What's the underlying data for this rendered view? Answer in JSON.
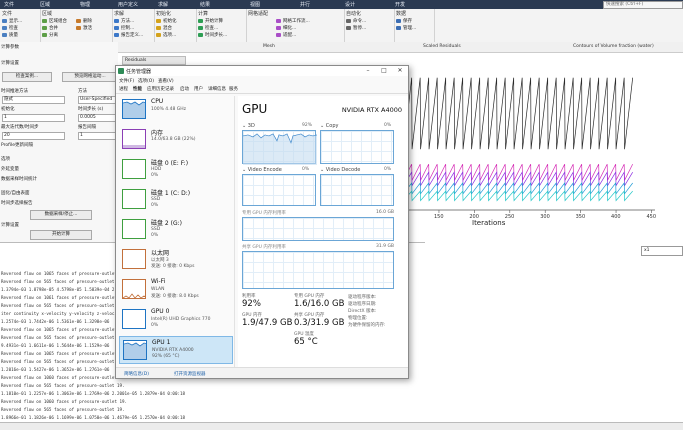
{
  "ribbon": {
    "tabs": [
      "文件",
      "区域",
      "物理",
      "用户定义",
      "求解",
      "结果",
      "视图",
      "并行",
      "设计",
      "开发"
    ],
    "search_placeholder": "快速搜索 (Ctrl+F)",
    "groups": [
      {
        "title": "文件",
        "items": [
          "显示...",
          "检查",
          "质量",
          "变换...",
          "制造..."
        ]
      },
      {
        "title": "区域",
        "items": [
          "区域组合",
          "合并",
          "分离",
          "删除",
          "激活"
        ]
      },
      {
        "title": "求解",
        "items": [
          "方法...",
          "控制...",
          "报告定义...",
          "监控..."
        ]
      },
      {
        "title": "初始化",
        "items": [
          "初始化",
          "混合",
          "选项...",
          "更多..."
        ]
      },
      {
        "title": "计算",
        "items": [
          "开始计算",
          "检查...",
          "时间步长..."
        ]
      },
      {
        "title": "网格适配",
        "items": [
          "网格工作流...",
          "细化...",
          "适配..."
        ]
      },
      {
        "title": "自动化",
        "items": [
          "命令...",
          "暂停..."
        ]
      },
      {
        "title": "数据",
        "items": [
          "保存",
          "管理..."
        ]
      }
    ]
  },
  "left_panel": {
    "rows": [
      "计算参数",
      "计算设置",
      "检查案例...",
      "预览网格运动...",
      "时间推进方法",
      "隐式",
      "初始化",
      "时间步长 (s)",
      "最大迭代数/时间步",
      "报告间隔",
      "Profile更新间隔",
      "选项",
      "外延变量",
      "数据采样时间统计",
      "固化/自由表面",
      "时间步选择报告",
      "计算设置",
      "开始计算"
    ],
    "buttons": [
      "检查案例...",
      "预览网格运动...",
      "数据采样/停止...",
      "开始计算"
    ],
    "fields": [
      "User-Specified",
      "0.0005",
      "1",
      "20",
      "1"
    ],
    "section_labels": [
      "方法",
      "时间步长",
      "步数"
    ]
  },
  "graphics": {
    "panes": [
      "Mesh",
      "Scaled Residuals",
      "Contours of Volume fraction (water)"
    ],
    "pane_tab": "Residuals",
    "x_axis_label": "Iterations",
    "x_ticks": [
      "100",
      "150",
      "200",
      "250",
      "300",
      "350",
      "400",
      "450"
    ],
    "dropdown_value": "x1"
  },
  "console": {
    "lines": [
      "Reversed flow on 1065 faces of pressure-outlet 19.",
      "Reversed flow on 565 faces of pressure-outlet 19.",
      "1.3794e-03  1.8798e-05  4.5798e-05  1.5839e-04  2.3345e-03",
      "Reversed flow on 1061 faces of pressure-outlet 19.",
      "Reversed flow on 565 faces of pressure-outlet 19.",
      "iter  continuity  x-velocity  y-velocity  z-velocity  energy",
      "1.2574e-03  1.7442e-06  1.5361e-06  1.3298e-06",
      "Reversed flow on 1065 faces of pressure-outlet 19.",
      "Reversed flow on 565 faces of pressure-outlet 19.",
      "9.4931e-01  1.6611e-06  1.5644e-06  1.1529e-06",
      "Reversed flow on 1065 faces of pressure-outlet 19.",
      "Reversed flow on 565 faces of pressure-outlet 19.",
      "1.2016e-03  1.5427e-06  1.3652e-06  1.2761e-06",
      "Reversed flow on 1060 faces of pressure-outlet 19.",
      "Reversed flow on 565 faces of pressure-outlet 19.",
      "1.1810e-01  1.2257e-06  1.3063e-06  1.2769e-06  2.2001e-05  1.2879e-04  0:00:18",
      "Reversed flow on 1060 faces of pressure-outlet 19.",
      "Reversed flow on 565 faces of pressure-outlet 19.",
      "1.8966e-01  1.1826e-06  1.1699e-06  1.0750e-06  1.4679e-05  1.2570e-04  0:00:18"
    ]
  },
  "task_manager": {
    "title": "任务管理器",
    "menu": [
      "文件(F)",
      "选项(O)",
      "查看(V)"
    ],
    "tabs": [
      "进程",
      "性能",
      "应用历史记录",
      "启动",
      "用户",
      "详细信息",
      "服务"
    ],
    "resources": [
      {
        "name": "CPU",
        "sub1": "100%  4.48 GHz",
        "sub2": ""
      },
      {
        "name": "内存",
        "sub1": "14.0/63.8 GB (22%)",
        "sub2": ""
      },
      {
        "name": "磁盘 0 (E: F:)",
        "sub1": "HDD",
        "sub2": "0%"
      },
      {
        "name": "磁盘 1 (C: D:)",
        "sub1": "SSD",
        "sub2": "0%"
      },
      {
        "name": "磁盘 2 (G:)",
        "sub1": "SSD",
        "sub2": "0%"
      },
      {
        "name": "以太网",
        "sub1": "以太网 3",
        "sub2": "发送: 0 接收: 0 Kbps"
      },
      {
        "name": "Wi-Fi",
        "sub1": "WLAN",
        "sub2": "发送: 0 接收: 8.0 Kbps"
      },
      {
        "name": "GPU 0",
        "sub1": "Intel(R) UHD Graphics 770",
        "sub2": "0%"
      },
      {
        "name": "GPU 1",
        "sub1": "NVIDIA RTX A4000",
        "sub2": "92% (65 °C)"
      }
    ],
    "detail": {
      "title": "GPU",
      "model": "NVIDIA RTX A4000",
      "graphs": [
        {
          "label": "3D",
          "pct": "92%"
        },
        {
          "label": "Copy",
          "pct": "0%"
        },
        {
          "label": "Video Encode",
          "pct": "0%"
        },
        {
          "label": "Video Decode",
          "pct": "0%"
        }
      ],
      "dedicated_label": "专用 GPU 内存利用率",
      "dedicated_max": "16.0 GB",
      "shared_label": "共享 GPU 内存利用率",
      "shared_max": "31.9 GB",
      "stats": [
        {
          "label": "利用率",
          "value": "92%"
        },
        {
          "label": "专用 GPU 内存",
          "value": "1.6/16.0 GB"
        },
        {
          "label": "GPU 内存",
          "value": "1.9/47.9 GB"
        },
        {
          "label": "共享 GPU 内存",
          "value": "0.3/31.9 GB"
        },
        {
          "label": "GPU 温度",
          "value": "65 °C"
        }
      ],
      "side_labels": [
        "驱动程序版本:",
        "驱动程序日期:",
        "DirectX 版本:",
        "物理位置:",
        "为硬件保留的内存:"
      ]
    },
    "footer": [
      "简略信息(D)",
      "打开资源监视器"
    ]
  },
  "chart_data": {
    "type": "line",
    "title": "",
    "xlabel": "Iterations",
    "ylabel": "",
    "x_ticks": [
      100,
      150,
      200,
      250,
      300,
      350,
      400,
      450
    ],
    "xlim": [
      95,
      455
    ],
    "grid": false,
    "series": [
      {
        "color": "#2a2a2a",
        "cycle_start": 0.55,
        "cycle_end": 0.02,
        "values_note": ""
      },
      {
        "color": "#d62fb6",
        "cycle_start": 0.78,
        "cycle_end": 0.66
      },
      {
        "color": "#8a2be2",
        "cycle_start": 0.82,
        "cycle_end": 0.72
      },
      {
        "color": "#1f9ad6",
        "cycle_start": 0.88,
        "cycle_end": 0.8
      },
      {
        "color": "#22c7c7",
        "cycle_start": 0.93,
        "cycle_end": 0.86
      }
    ],
    "period": 12
  }
}
